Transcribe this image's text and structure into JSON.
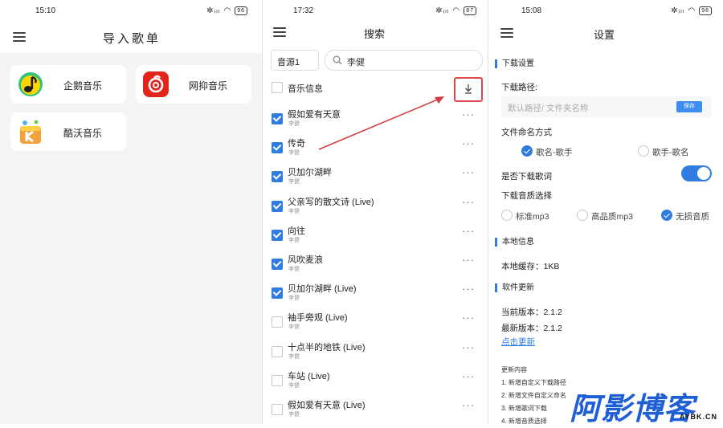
{
  "panel_import": {
    "status_time": "15:10",
    "battery": "96",
    "title": "导入歌单",
    "sources": [
      {
        "label": "企鹅音乐",
        "icon": "qq-music-logo-icon"
      },
      {
        "label": "网抑音乐",
        "icon": "netease-music-logo-icon"
      },
      {
        "label": "酷沃音乐",
        "icon": "kuwo-music-logo-icon"
      }
    ]
  },
  "panel_search": {
    "status_time": "17:32",
    "battery": "87",
    "title": "搜索",
    "source_select": "音源1",
    "search_value": "李健",
    "header_label": "音乐信息",
    "songs": [
      {
        "name": "假如爱有天意",
        "artist": "李健",
        "checked": true
      },
      {
        "name": "传奇",
        "artist": "李健",
        "checked": true
      },
      {
        "name": "贝加尔湖畔",
        "artist": "李健",
        "checked": true
      },
      {
        "name": "父亲写的散文诗 (Live)",
        "artist": "李健",
        "checked": true
      },
      {
        "name": "向往",
        "artist": "李健",
        "checked": true
      },
      {
        "name": "风吹麦浪",
        "artist": "李健",
        "checked": true
      },
      {
        "name": "贝加尔湖畔 (Live)",
        "artist": "李健",
        "checked": true
      },
      {
        "name": "袖手旁观 (Live)",
        "artist": "李健",
        "checked": false
      },
      {
        "name": "十点半的地铁 (Live)",
        "artist": "李健",
        "checked": false
      },
      {
        "name": "车站 (Live)",
        "artist": "李健",
        "checked": false
      },
      {
        "name": "假如爱有天意 (Live)",
        "artist": "李健",
        "checked": false
      }
    ],
    "more_glyph": "···"
  },
  "panel_settings": {
    "status_time": "15:08",
    "battery": "96",
    "title": "设置",
    "download_section": "下载设置",
    "path_label": "下载路径:",
    "path_placeholder": "默认路径/  文件夹名称",
    "save_label": "保存",
    "naming_label": "文件命名方式",
    "naming_options": [
      {
        "label": "歌名-歌手",
        "selected": true
      },
      {
        "label": "歌手-歌名",
        "selected": false
      }
    ],
    "lyrics_label": "是否下载歌词",
    "lyrics_on": true,
    "quality_label": "下载音质选择",
    "quality_options": [
      {
        "label": "标准mp3",
        "selected": false
      },
      {
        "label": "高品质mp3",
        "selected": false
      },
      {
        "label": "无损音质",
        "selected": true
      }
    ],
    "local_section": "本地信息",
    "cache_text": "本地缓存：1KB",
    "update_section": "软件更新",
    "current_version": "当前版本：2.1.2",
    "latest_version": "最新版本：2.1.2",
    "update_link": "点击更新",
    "changelog_title": "更新内容",
    "changelog": [
      "1. 新增自定义下载路径",
      "2. 新增文件自定义命名",
      "3. 新增歌词下载",
      "4. 新增音质选择"
    ]
  },
  "watermark": {
    "main": "阿影博客",
    "sub": "AYBK.CN"
  },
  "colors": {
    "accent": "#2f7de1",
    "highlight": "#e0474c",
    "watermark": "#1f5fd6"
  }
}
